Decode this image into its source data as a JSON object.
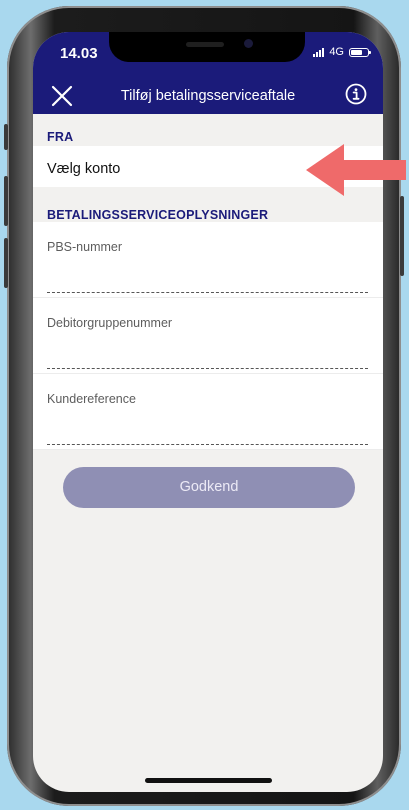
{
  "status_bar": {
    "time": "14.03",
    "network": "4G"
  },
  "nav": {
    "title": "Tilføj betalingsserviceaftale",
    "close_icon": "close-icon",
    "info_icon": "info-icon"
  },
  "from_section": {
    "header": "FRA",
    "account_placeholder": "Vælg konto"
  },
  "details_section": {
    "header": "BETALINGSSERVICEOPLYSNINGER",
    "fields": [
      {
        "label": "PBS-nummer",
        "value": ""
      },
      {
        "label": "Debitorgruppenummer",
        "value": ""
      },
      {
        "label": "Kundereference",
        "value": ""
      }
    ]
  },
  "approve_button": {
    "label": "Godkend",
    "enabled": false
  },
  "annotation": {
    "icon": "red-arrow-pointer",
    "color": "#ef6a6a"
  },
  "colors": {
    "brand_navy": "#1b1b7a",
    "background": "#f2f1ef",
    "disabled_button": "#8f8fb4",
    "page_background": "#a9d8ee"
  }
}
